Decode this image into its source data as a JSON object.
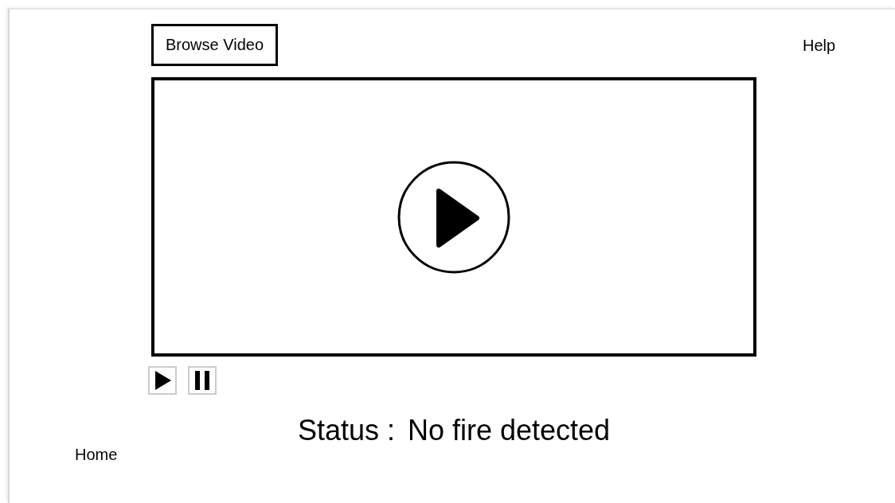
{
  "header": {
    "browse_button": "Browse Video",
    "help_link": "Help"
  },
  "controls": [
    {
      "kind": "play"
    },
    {
      "kind": "pause"
    }
  ],
  "status": {
    "label": "Status :",
    "value": "No fire detected"
  },
  "footer": {
    "home_link": "Home"
  }
}
